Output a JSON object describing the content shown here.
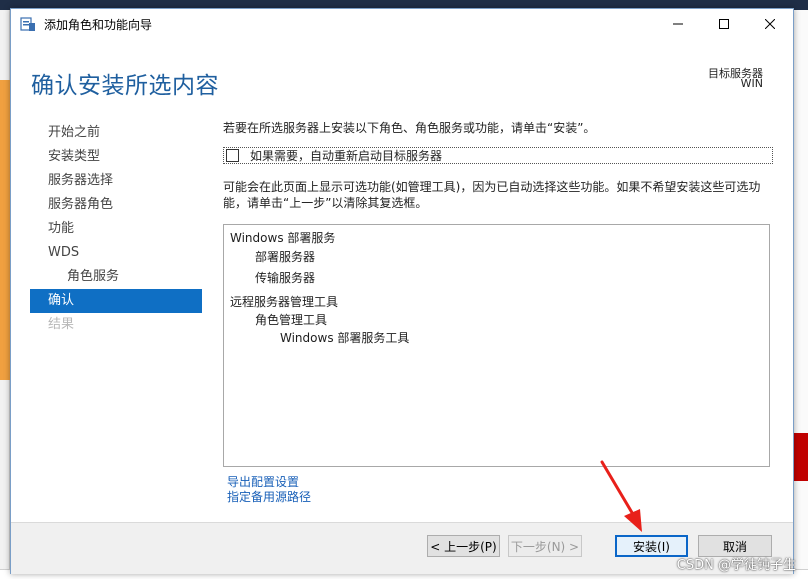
{
  "window": {
    "title": "添加角色和功能向导"
  },
  "header": {
    "page_title": "确认安装所选内容",
    "target_label": "目标服务器",
    "target_value": "WIN"
  },
  "nav": {
    "items": [
      {
        "label": "开始之前",
        "state": "normal"
      },
      {
        "label": "安装类型",
        "state": "normal"
      },
      {
        "label": "服务器选择",
        "state": "normal"
      },
      {
        "label": "服务器角色",
        "state": "normal"
      },
      {
        "label": "功能",
        "state": "normal"
      },
      {
        "label": "WDS",
        "state": "normal"
      },
      {
        "label": "角色服务",
        "state": "sub"
      },
      {
        "label": "确认",
        "state": "active"
      },
      {
        "label": "结果",
        "state": "disabled"
      }
    ]
  },
  "content": {
    "intro": "若要在所选服务器上安装以下角色、角色服务或功能，请单击“安装”。",
    "restart_label": "如果需要，自动重新启动目标服务器",
    "restart_checked": false,
    "note": "可能会在此页面上显示可选功能(如管理工具)，因为已自动选择这些功能。如果不希望安装这些可选功能，请单击“上一步”以清除其复选框。",
    "tree": [
      {
        "text": "Windows 部署服务",
        "level": 0
      },
      {
        "text": "部署服务器",
        "level": 1
      },
      {
        "text": "传输服务器",
        "level": 1
      },
      {
        "text": "远程服务器管理工具",
        "level": 0
      },
      {
        "text": "角色管理工具",
        "level": 1
      },
      {
        "text": "Windows 部署服务工具",
        "level": 2
      }
    ],
    "links": {
      "export": "导出配置设置",
      "alt_source": "指定备用源路径"
    }
  },
  "footer": {
    "prev": "< 上一步(P)",
    "next": "下一步(N) >",
    "install": "安装(I)",
    "cancel": "取消"
  },
  "watermark": "CSDN @学徒钝子生",
  "colors": {
    "accent": "#0f6fc4",
    "title": "#1f5f9f",
    "link": "#1960b8",
    "arrow": "#e8201a"
  }
}
